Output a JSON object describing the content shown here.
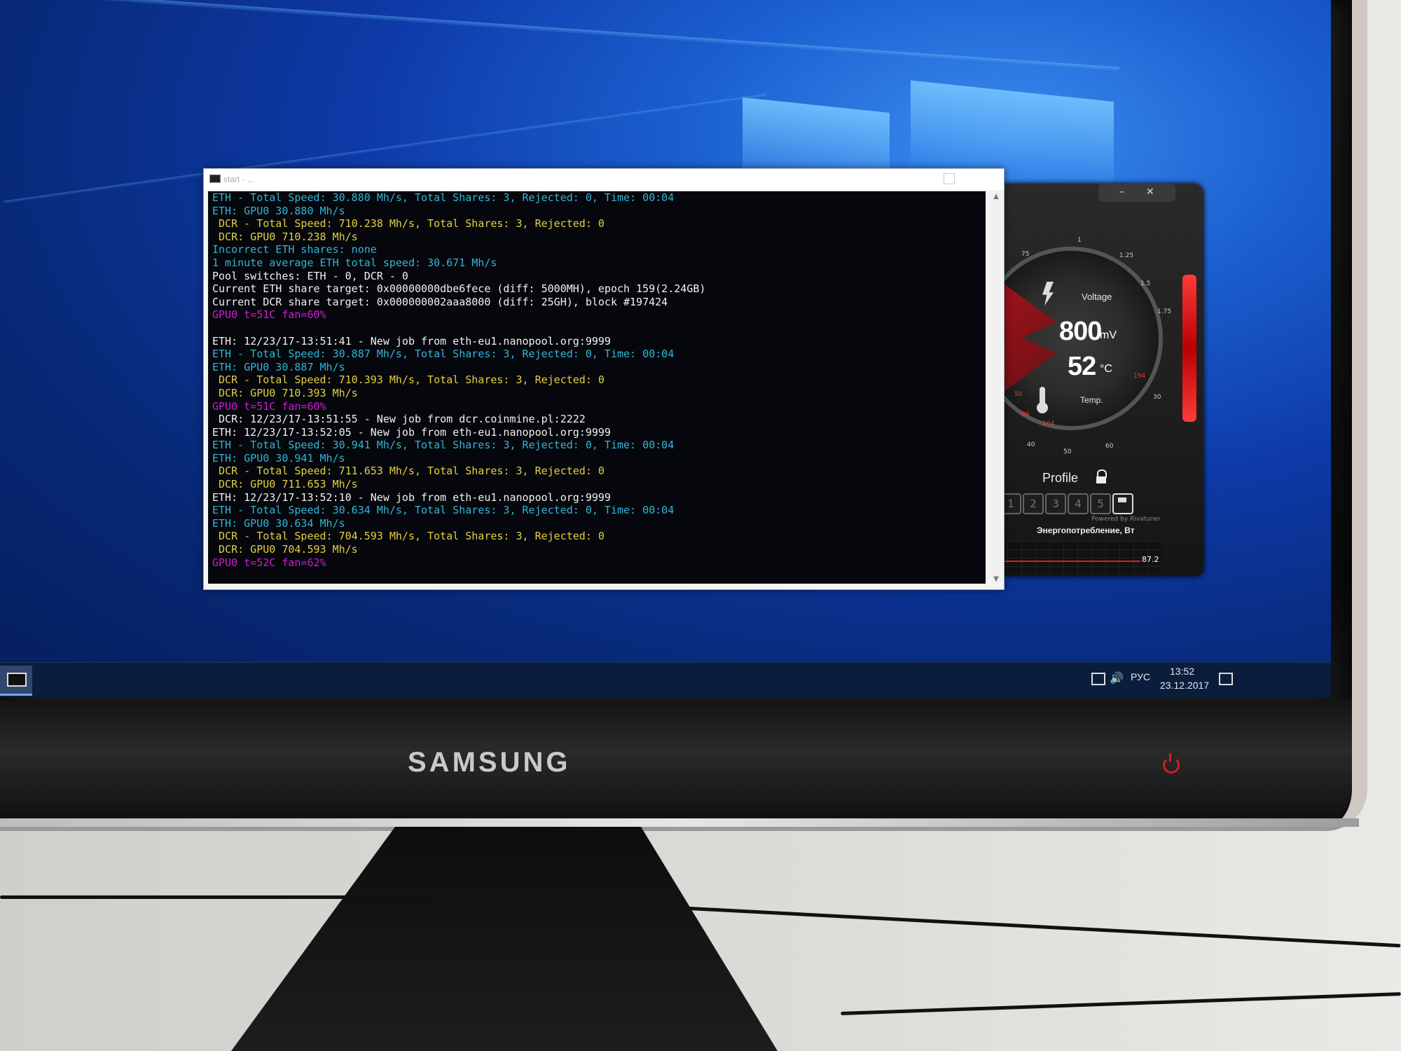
{
  "console": {
    "title": "start - ...",
    "lines": [
      {
        "text": "ETH - Total Speed: 30.880 Mh/s, Total Shares: 3, Rejected: 0, Time: 00:04",
        "color": "cyan"
      },
      {
        "text": "ETH: GPU0 30.880 Mh/s",
        "color": "cyan"
      },
      {
        "text": " DCR - Total Speed: 710.238 Mh/s, Total Shares: 3, Rejected: 0",
        "color": "yellow"
      },
      {
        "text": " DCR: GPU0 710.238 Mh/s",
        "color": "yellow"
      },
      {
        "text": "Incorrect ETH shares: none",
        "color": "cyan"
      },
      {
        "text": "1 minute average ETH total speed: 30.671 Mh/s",
        "color": "cyan"
      },
      {
        "text": "Pool switches: ETH - 0, DCR - 0",
        "color": "white"
      },
      {
        "text": "Current ETH share target: 0x00000000dbe6fece (diff: 5000MH), epoch 159(2.24GB)",
        "color": "white"
      },
      {
        "text": "Current DCR share target: 0x000000002aaa8000 (diff: 25GH), block #197424",
        "color": "white"
      },
      {
        "text": "GPU0 t=51C fan=60%",
        "color": "magenta"
      },
      {
        "text": " ",
        "color": "blank"
      },
      {
        "text": "ETH: 12/23/17-13:51:41 - New job from eth-eu1.nanopool.org:9999",
        "color": "white"
      },
      {
        "text": "ETH - Total Speed: 30.887 Mh/s, Total Shares: 3, Rejected: 0, Time: 00:04",
        "color": "cyan"
      },
      {
        "text": "ETH: GPU0 30.887 Mh/s",
        "color": "cyan"
      },
      {
        "text": " DCR - Total Speed: 710.393 Mh/s, Total Shares: 3, Rejected: 0",
        "color": "yellow"
      },
      {
        "text": " DCR: GPU0 710.393 Mh/s",
        "color": "yellow"
      },
      {
        "text": "GPU0 t=51C fan=60%",
        "color": "magenta"
      },
      {
        "text": " DCR: 12/23/17-13:51:55 - New job from dcr.coinmine.pl:2222",
        "color": "white"
      },
      {
        "text": "ETH: 12/23/17-13:52:05 - New job from eth-eu1.nanopool.org:9999",
        "color": "white"
      },
      {
        "text": "ETH - Total Speed: 30.941 Mh/s, Total Shares: 3, Rejected: 0, Time: 00:04",
        "color": "cyan"
      },
      {
        "text": "ETH: GPU0 30.941 Mh/s",
        "color": "cyan"
      },
      {
        "text": " DCR - Total Speed: 711.653 Mh/s, Total Shares: 3, Rejected: 0",
        "color": "yellow"
      },
      {
        "text": " DCR: GPU0 711.653 Mh/s",
        "color": "yellow"
      },
      {
        "text": "ETH: 12/23/17-13:52:10 - New job from eth-eu1.nanopool.org:9999",
        "color": "white"
      },
      {
        "text": "ETH - Total Speed: 30.634 Mh/s, Total Shares: 3, Rejected: 0, Time: 00:04",
        "color": "cyan"
      },
      {
        "text": "ETH: GPU0 30.634 Mh/s",
        "color": "cyan"
      },
      {
        "text": " DCR - Total Speed: 704.593 Mh/s, Total Shares: 3, Rejected: 0",
        "color": "yellow"
      },
      {
        "text": " DCR: GPU0 704.593 Mh/s",
        "color": "yellow"
      },
      {
        "text": "GPU0 t=52C fan=62%",
        "color": "magenta"
      }
    ]
  },
  "afterburner": {
    "voltage_label": "Voltage",
    "voltage_value": "800",
    "voltage_unit": "mV",
    "temp_value": "52",
    "temp_unit": "°C",
    "temp_label": "Temp.",
    "ticks_top": [
      "75",
      "1",
      "1.25",
      "1.5",
      "1.75"
    ],
    "ticks_bottom": [
      "50",
      "68",
      "86",
      "104",
      "194",
      "30",
      "40",
      "50",
      "60"
    ],
    "profile_label": "Profile",
    "profile_slots": [
      "1",
      "2",
      "3",
      "4",
      "5"
    ],
    "powered_by": "Powered by Rivatuner",
    "graph_title": "Энергопотребление, Вт",
    "graph_value": "87.2"
  },
  "taskbar": {
    "language": "РУС",
    "time": "13:52",
    "date": "23.12.2017"
  },
  "monitor": {
    "brand": "SAMSUNG"
  }
}
